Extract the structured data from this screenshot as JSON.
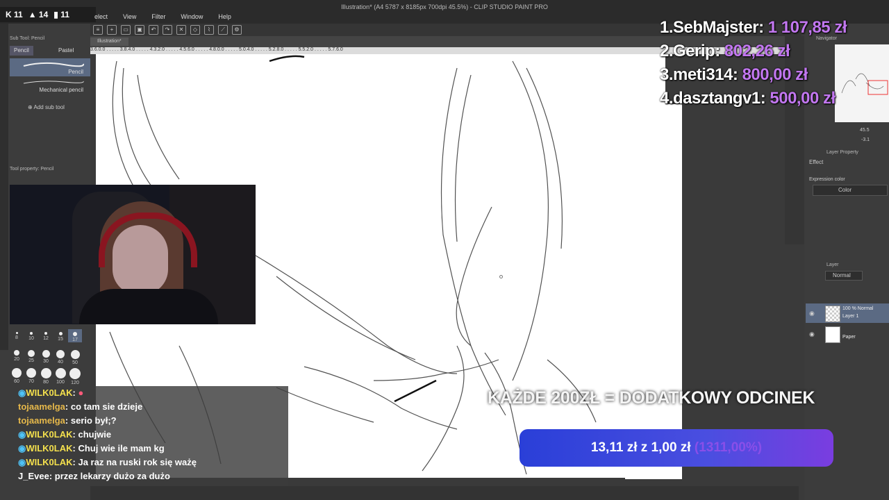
{
  "window": {
    "title": "Illustration* (A4 5787 x 8185px 700dpi 45.5%) - CLIP STUDIO PAINT PRO",
    "doc_tab": "Illustration*"
  },
  "menu": [
    "elect",
    "View",
    "Filter",
    "Window",
    "Help"
  ],
  "stream_stats": {
    "a": "11",
    "b": "14",
    "c": "11"
  },
  "ruler_scale": "3.6.0.0 . . . . . 3.8.4.0 . . . . . 4.3.2.0 . . . . . 4.5.6.0 . . . . . 4.8.0.0 . . . . . 5.0.4.0 . . . . . 5.2.8.0 . . . . . 5.5.2.0 . . . . . 5.7.6.0",
  "left_panel": {
    "subtool_header": "Sub Tool: Pencil",
    "tabs": [
      "Pencil",
      "Pastel"
    ],
    "brushes": [
      "Pencil",
      "Mechanical pencil"
    ],
    "add_subtool": "Add sub tool",
    "toolprop_header": "Tool property: Pencil",
    "brush_sizes": [
      "8",
      "10",
      "12",
      "15",
      "17",
      "20",
      "25",
      "30",
      "40",
      "50",
      "60",
      "70",
      "80",
      "100",
      "120"
    ]
  },
  "right_panel": {
    "navigator": "Navigator",
    "zoom": "45.5",
    "angle": "-3.1",
    "layer_property": "Layer Property",
    "effect": "Effect",
    "expression_color": "Expression color",
    "color_option": "Color",
    "layer_header": "Layer",
    "blend_mode": "Normal",
    "layers": [
      {
        "line1": "100 % Normal",
        "line2": "Layer 1"
      },
      {
        "line1": "",
        "line2": "Paper"
      }
    ]
  },
  "chat": [
    {
      "name": "WILK0LAK",
      "text": "",
      "color": "#f4e04d"
    },
    {
      "name": "tojaamelga",
      "text": "co tam sie dzieje",
      "color": "#e6b84a"
    },
    {
      "name": "tojaamelga",
      "text": "serio był;?",
      "color": "#e6b84a"
    },
    {
      "name": "WILK0LAK",
      "text": "chujwie",
      "color": "#f4e04d"
    },
    {
      "name": "WILK0LAK",
      "text": "Chuj wie ile mam kg",
      "color": "#f4e04d"
    },
    {
      "name": "WILK0LAK",
      "text": "Ja raz na ruski rok się ważę",
      "color": "#f4e04d"
    },
    {
      "name": "J_Evee",
      "text": "przez lekarzy dużo za dużo",
      "color": "#ffffff"
    }
  ],
  "leaderboard": [
    {
      "rank": "1.",
      "name": "SebMajster:",
      "amount": "1 107,85 zł"
    },
    {
      "rank": "2.",
      "name": "Gerip:",
      "amount": "802,26 zł"
    },
    {
      "rank": "3.",
      "name": "meti314:",
      "amount": "800,00 zł"
    },
    {
      "rank": "4.",
      "name": "dasztangv1:",
      "amount": "500,00 zł"
    }
  ],
  "promo": {
    "text": "KAŻDE 200ZŁ = DODATKOWY ODCINEK",
    "goal_current": "13,11 zł",
    "goal_sep": "z",
    "goal_target": "1,00 zł",
    "goal_percent": "(1311,00%)"
  },
  "colors": {
    "accent": "#c277f0",
    "goal_bar": "#3a48dc",
    "panel": "#3c3c3c"
  }
}
